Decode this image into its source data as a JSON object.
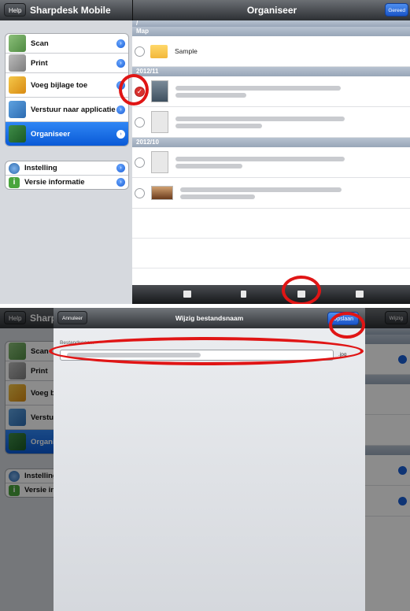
{
  "screen1": {
    "left_nav": {
      "help_label": "Help",
      "title": "Sharpdesk Mobile"
    },
    "right_nav": {
      "title": "Organiseer",
      "done_label": "Gereed"
    },
    "menu_main": [
      {
        "label": "Scan",
        "icon": "scan-icon"
      },
      {
        "label": "Print",
        "icon": "print-icon"
      },
      {
        "label": "Voeg bijlage toe",
        "icon": "attach-icon"
      },
      {
        "label": "Verstuur naar applicatie",
        "icon": "send-to-app-icon"
      },
      {
        "label": "Organiseer",
        "icon": "organise-icon",
        "selected": true
      }
    ],
    "menu_extra": [
      {
        "label": "Instelling",
        "icon": "gear-icon"
      },
      {
        "label": "Versie informatie",
        "icon": "info-icon"
      }
    ],
    "path": "/",
    "sections": [
      {
        "header": "Map",
        "items": [
          {
            "name": "Sample",
            "type": "folder"
          }
        ]
      },
      {
        "header": "2012/11",
        "items": [
          {
            "type": "file",
            "checked": true
          },
          {
            "type": "file"
          }
        ]
      },
      {
        "header": "2012/10",
        "items": [
          {
            "type": "file"
          },
          {
            "type": "file"
          }
        ]
      }
    ]
  },
  "screen2": {
    "left_nav": {
      "help_label": "Help",
      "title": "Sharp"
    },
    "right_nav": {
      "right_label": "Wijzig"
    },
    "menu_main": [
      "Scan",
      "Print",
      "Voeg b",
      "Verstu",
      "Organi"
    ],
    "menu_extra": [
      "Instelling",
      "Versie in"
    ],
    "modal": {
      "cancel_label": "Annuleer",
      "title": "Wijzig bestandsnaam",
      "save_label": "Opslaan",
      "field_label": "Bestandsnaam",
      "extension": ".jpg"
    }
  },
  "colors": {
    "annotation_ring": "#e01515",
    "accent_blue": "#0a5ad7"
  }
}
